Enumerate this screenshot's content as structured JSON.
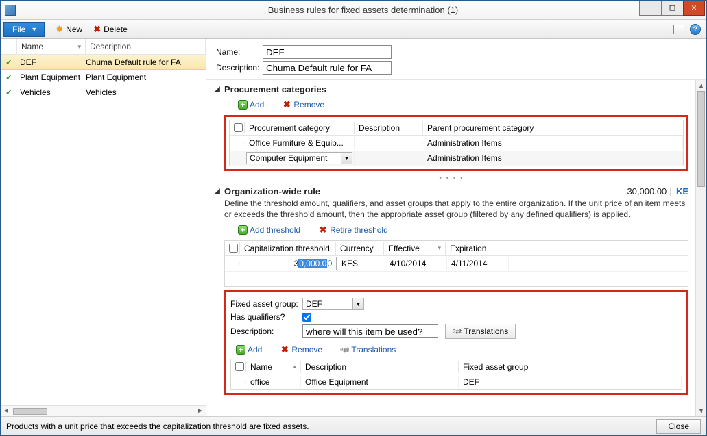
{
  "titlebar": {
    "title": "Business rules for fixed assets determination (1)"
  },
  "toolbar": {
    "file": "File",
    "new": "New",
    "delete": "Delete"
  },
  "leftgrid": {
    "headers": {
      "name": "Name",
      "description": "Description"
    },
    "rows": [
      {
        "name": "DEF",
        "description": "Chuma Default rule for FA",
        "selected": true
      },
      {
        "name": "Plant Equipment",
        "description": "Plant Equipment",
        "selected": false
      },
      {
        "name": "Vehicles",
        "description": "Vehicles",
        "selected": false
      }
    ]
  },
  "form": {
    "name_label": "Name:",
    "name_value": "DEF",
    "desc_label": "Description:",
    "desc_value": "Chuma Default rule for FA"
  },
  "proc_section": {
    "title": "Procurement categories",
    "add": "Add",
    "remove": "Remove",
    "headers": {
      "cat": "Procurement category",
      "desc": "Description",
      "parent": "Parent procurement category"
    },
    "rows": [
      {
        "cat": "Office Furniture & Equip...",
        "desc": "",
        "parent": "Administration Items"
      },
      {
        "cat": "Computer Equipment",
        "desc": "",
        "parent": "Administration Items",
        "dropdown": true
      }
    ]
  },
  "org_section": {
    "title": "Organization-wide rule",
    "amount": "30,000.00",
    "ke": "KE",
    "description": "Define the threshold amount, qualifiers, and asset groups that apply to the entire organization. If the unit price of an item meets or exceeds the threshold amount, then the appropriate asset group (filtered by any defined qualifiers) is applied.",
    "add_threshold": "Add threshold",
    "retire_threshold": "Retire threshold",
    "headers": {
      "cap": "Capitalization threshold",
      "cur": "Currency",
      "eff": "Effective",
      "exp": "Expiration"
    },
    "row": {
      "cap_prefix": "3",
      "cap_sel": "0,000.0",
      "cap_suffix": "0",
      "cur": "KES",
      "eff": "4/10/2014",
      "exp": "4/11/2014"
    }
  },
  "fag": {
    "label": "Fixed asset group:",
    "value": "DEF",
    "hasq_label": "Has qualifiers?",
    "desc_label": "Description:",
    "desc_value": "where will this item be used?",
    "translations": "Translations",
    "add": "Add",
    "remove": "Remove",
    "headers": {
      "name": "Name",
      "desc": "Description",
      "fag": "Fixed asset group"
    },
    "row": {
      "name": "office",
      "desc": "Office Equipment",
      "fag": "DEF"
    }
  },
  "status": {
    "text": "Products with a unit price that exceeds the capitalization threshold are fixed assets.",
    "close": "Close"
  }
}
